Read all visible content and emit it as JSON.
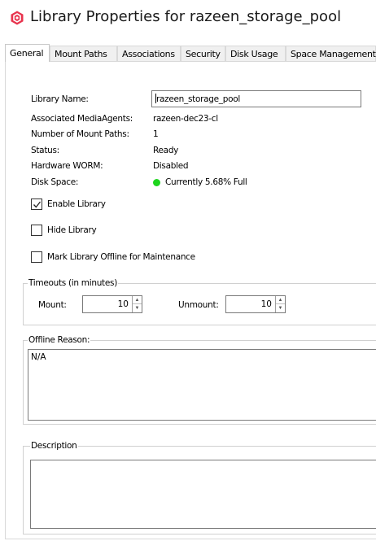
{
  "window": {
    "title": "Library Properties for razeen_storage_pool"
  },
  "tabs": [
    {
      "label": "General",
      "active": true
    },
    {
      "label": "Mount Paths"
    },
    {
      "label": "Associations"
    },
    {
      "label": "Security"
    },
    {
      "label": "Disk Usage"
    },
    {
      "label": "Space Management"
    }
  ],
  "general": {
    "library_name_label": "Library Name:",
    "library_name_value": "razeen_storage_pool",
    "media_agents_label": "Associated MediaAgents:",
    "media_agents_value": "razeen-dec23-cl",
    "mount_paths_label": "Number of Mount Paths:",
    "mount_paths_value": "1",
    "status_label": "Status:",
    "status_value": "Ready",
    "worm_label": "Hardware WORM:",
    "worm_value": "Disabled",
    "disk_space_label": "Disk Space:",
    "disk_space_value": "Currently 5.68% Full",
    "disk_status_color": "#1ed51e"
  },
  "checkboxes": {
    "enable_library": {
      "label": "Enable Library",
      "checked": true
    },
    "hide_library": {
      "label": "Hide Library",
      "checked": false
    },
    "offline_maintenance": {
      "label": "Mark Library Offline for Maintenance",
      "checked": false
    }
  },
  "timeouts": {
    "title": "Timeouts (in minutes)",
    "mount_label": "Mount:",
    "mount_value": "10",
    "unmount_label": "Unmount:",
    "unmount_value": "10"
  },
  "offline_reason": {
    "title": "Offline Reason:",
    "value": "N/A"
  },
  "description": {
    "title": "Description",
    "value": ""
  },
  "colors": {
    "app_icon": "#e8344e",
    "status_green": "#1ed51e"
  }
}
